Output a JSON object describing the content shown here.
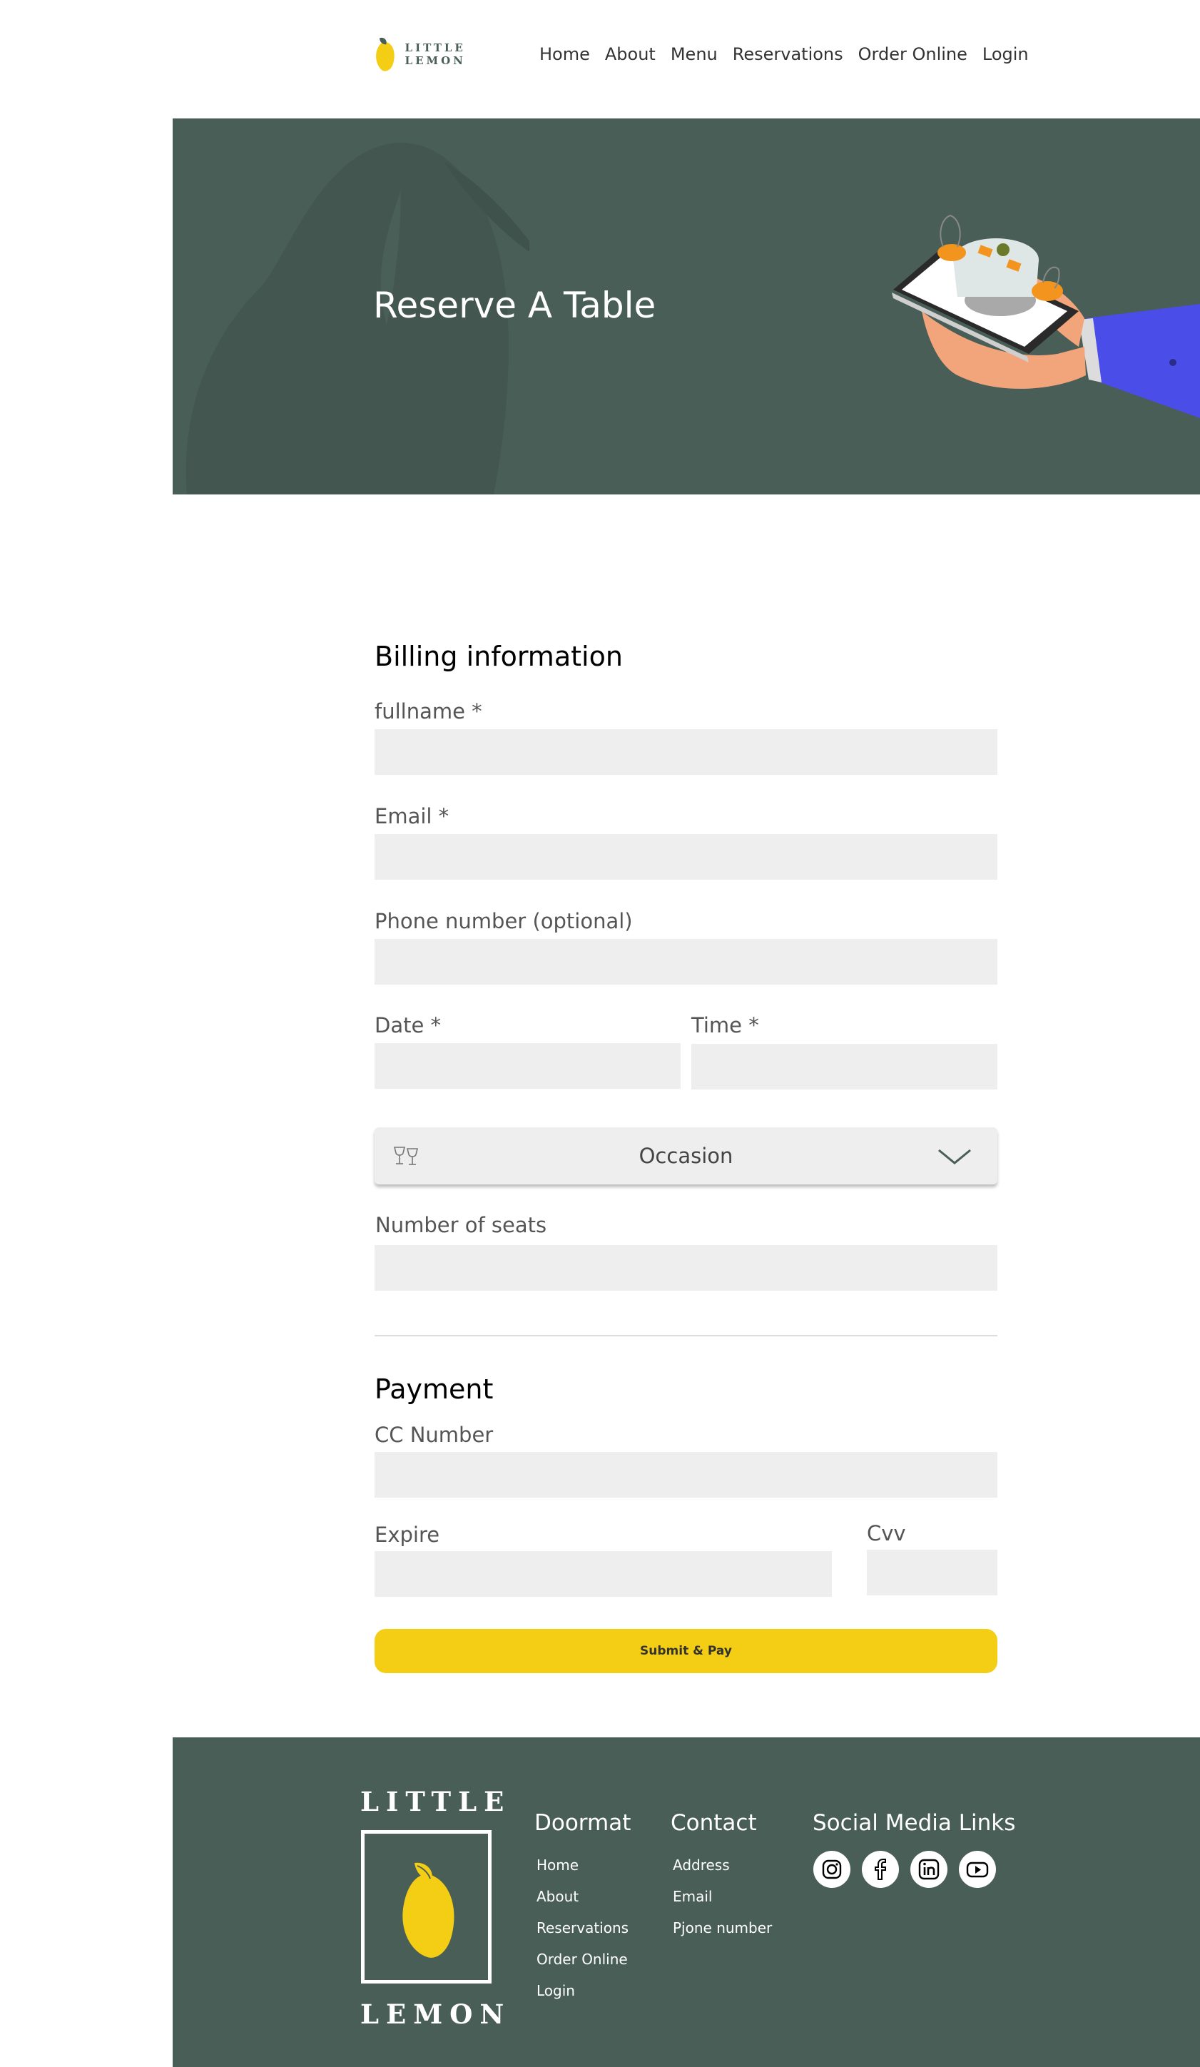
{
  "nav": {
    "brand": "LITTLE LEMON",
    "links": [
      "Home",
      "About",
      "Menu",
      "Reservations",
      "Order Online",
      "Login"
    ]
  },
  "hero": {
    "title": "Reserve A Table"
  },
  "billing": {
    "heading": "Billing information",
    "fullname_label": "fullname *",
    "email_label": "Email *",
    "phone_label": "Phone number (optional)",
    "date_label": "Date *",
    "time_label": "Time *",
    "occasion_label": "Occasion",
    "seats_label": "Number of seats"
  },
  "payment": {
    "heading": "Payment",
    "cc_label": "CC Number",
    "expire_label": "Expire",
    "cvv_label": "Cvv",
    "submit_label": "Submit & Pay"
  },
  "footer": {
    "brand_top": "LITTLE",
    "brand_bottom": "LEMON",
    "doormat": {
      "title": "Doormat",
      "links": [
        "Home",
        "About",
        "Reservations",
        "Order Online",
        "Login"
      ]
    },
    "contact": {
      "title": "Contact",
      "links": [
        "Address",
        "Email",
        "Pjone number"
      ]
    },
    "social": {
      "title": "Social Media Links",
      "icons": [
        "instagram-icon",
        "facebook-icon",
        "linkedin-icon",
        "youtube-icon"
      ]
    }
  },
  "colors": {
    "primary_green": "#495e57",
    "primary_yellow": "#f4ce14",
    "input_bg": "#edeeed",
    "accent_blue": "#4b4de8"
  }
}
